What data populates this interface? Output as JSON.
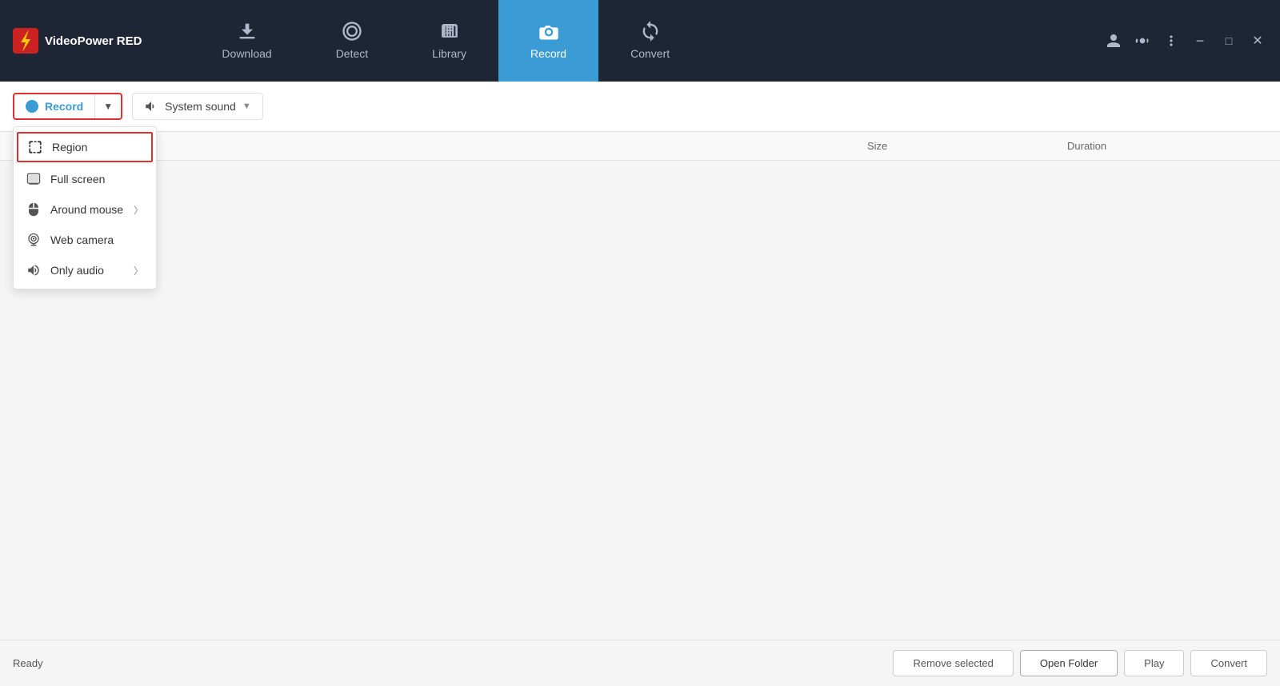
{
  "app": {
    "name": "VideoPower RED"
  },
  "nav": {
    "tabs": [
      {
        "id": "download",
        "label": "Download",
        "active": false
      },
      {
        "id": "detect",
        "label": "Detect",
        "active": false
      },
      {
        "id": "library",
        "label": "Library",
        "active": false
      },
      {
        "id": "record",
        "label": "Record",
        "active": true
      },
      {
        "id": "convert",
        "label": "Convert",
        "active": false
      }
    ]
  },
  "toolbar": {
    "record_label": "Record",
    "system_sound_label": "System sound"
  },
  "dropdown": {
    "items": [
      {
        "id": "region",
        "label": "Region",
        "selected": true,
        "has_arrow": false
      },
      {
        "id": "fullscreen",
        "label": "Full screen",
        "selected": false,
        "has_arrow": false
      },
      {
        "id": "around-mouse",
        "label": "Around mouse",
        "selected": false,
        "has_arrow": true
      },
      {
        "id": "web-camera",
        "label": "Web camera",
        "selected": false,
        "has_arrow": false
      },
      {
        "id": "only-audio",
        "label": "Only audio",
        "selected": false,
        "has_arrow": true
      }
    ]
  },
  "table": {
    "columns": [
      {
        "id": "name",
        "label": ""
      },
      {
        "id": "size",
        "label": "Size"
      },
      {
        "id": "duration",
        "label": "Duration"
      }
    ]
  },
  "bottom": {
    "status": "Ready",
    "remove_selected": "Remove selected",
    "open_folder": "Open Folder",
    "play": "Play",
    "convert": "Convert"
  }
}
